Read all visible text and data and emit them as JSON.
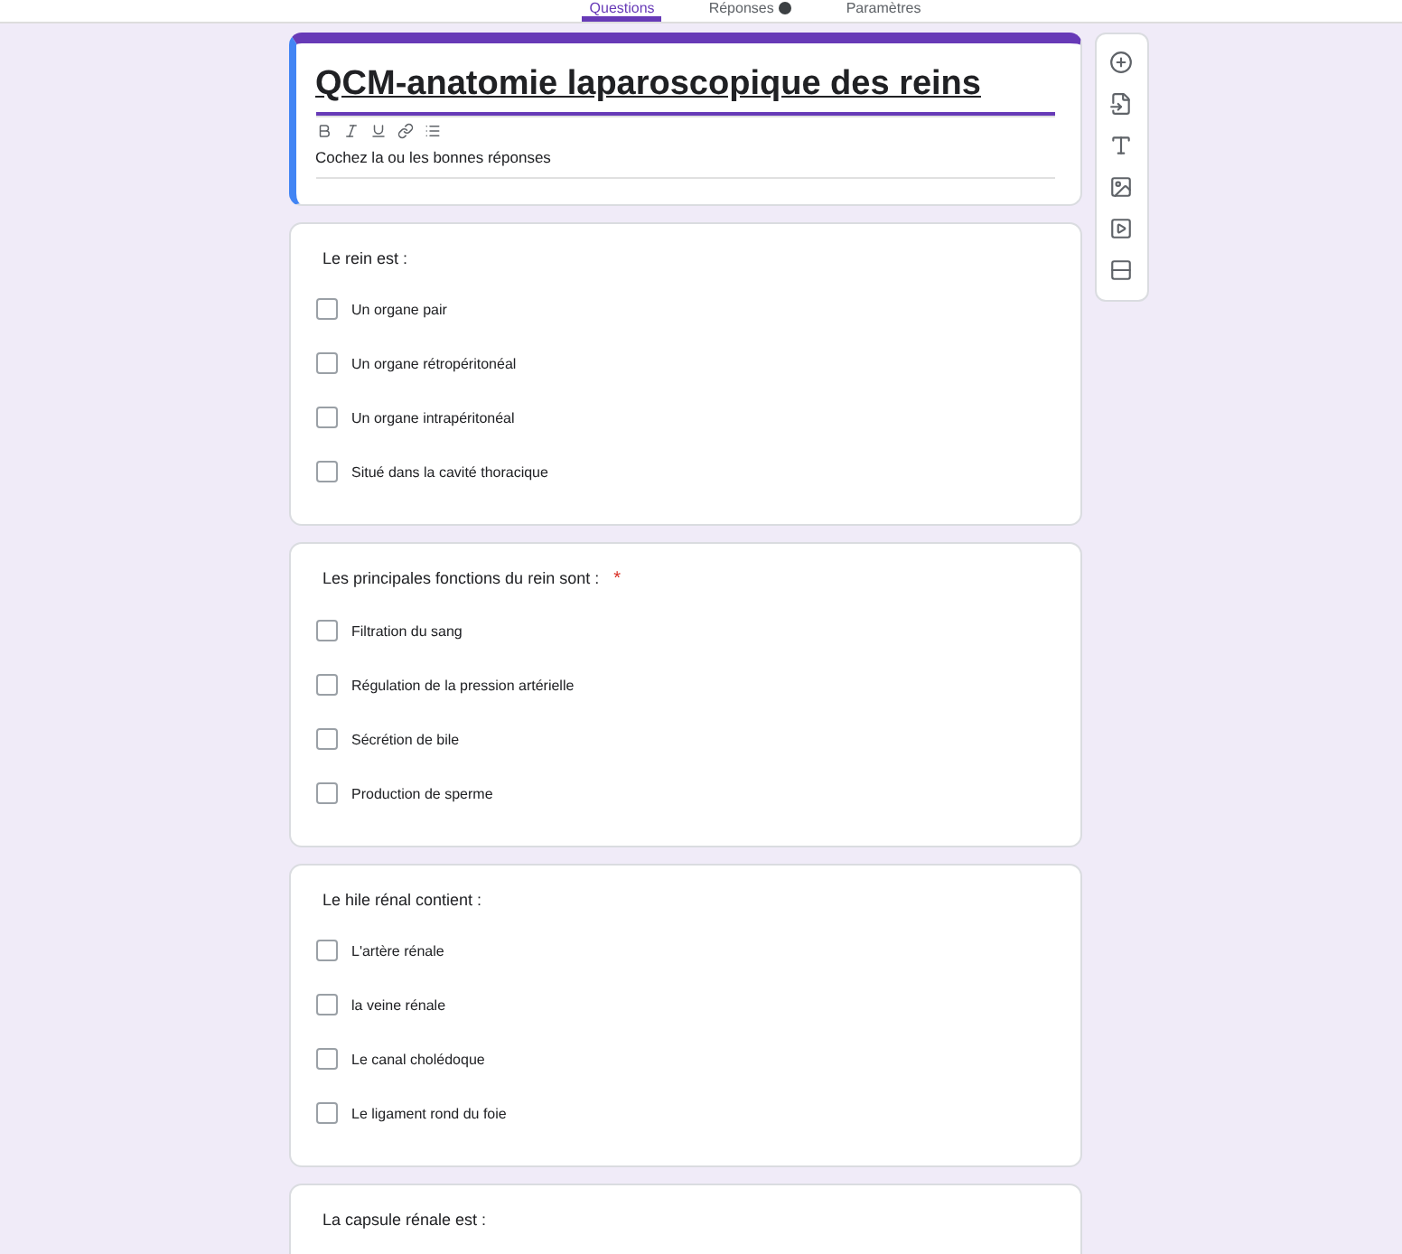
{
  "tabs": [
    {
      "label": "Questions",
      "selected": true,
      "badge": false
    },
    {
      "label": "Réponses",
      "selected": false,
      "badge": true
    },
    {
      "label": "Paramètres",
      "selected": false,
      "badge": false
    }
  ],
  "form": {
    "title": "QCM-anatomie laparoscopique des reins",
    "description": "Cochez la ou les bonnes réponses"
  },
  "questions": [
    {
      "title": "Le rein est :",
      "options": [
        {
          "label": "Un organe pair",
          "checked": false
        },
        {
          "label": "Un organe rétropéritonéal",
          "checked": false
        },
        {
          "label": "Un organe intrapéritonéal",
          "checked": false
        },
        {
          "label": "Situé dans la cavité thoracique",
          "checked": false
        }
      ]
    },
    {
      "title": "Les principales fonctions du rein sont :",
      "required_mark": "*",
      "options": [
        {
          "label": "Filtration du sang",
          "checked": false
        },
        {
          "label": "Régulation de la pression artérielle",
          "checked": false
        },
        {
          "label": "Sécrétion de bile",
          "checked": false
        },
        {
          "label": "Production de sperme",
          "checked": false
        }
      ]
    },
    {
      "title": "Le hile rénal contient :",
      "options": [
        {
          "label": "L'artère rénale",
          "checked": false
        },
        {
          "label": "la veine rénale",
          "checked": false
        },
        {
          "label": "Le canal cholédoque",
          "checked": false
        },
        {
          "label": "Le ligament rond du foie",
          "checked": false
        }
      ]
    },
    {
      "title": "La capsule rénale est :"
    }
  ]
}
